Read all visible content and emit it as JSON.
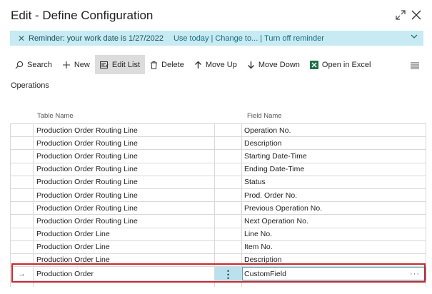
{
  "window": {
    "title": "Edit - Define Configuration"
  },
  "banner": {
    "message": "Reminder: your work date is 1/27/2022",
    "links": [
      "Use today",
      "Change to...",
      "Turn off reminder"
    ]
  },
  "toolbar": {
    "search": "Search",
    "new": "New",
    "edit_list": "Edit List",
    "delete": "Delete",
    "move_up": "Move Up",
    "move_down": "Move Down",
    "open_in_excel": "Open in Excel"
  },
  "section_title": "Operations",
  "columns": {
    "table_name": "Table Name",
    "field_name": "Field Name"
  },
  "rows": [
    {
      "table": "Production Order Routing Line",
      "field": "Operation No."
    },
    {
      "table": "Production Order Routing Line",
      "field": "Description"
    },
    {
      "table": "Production Order Routing Line",
      "field": "Starting Date-Time"
    },
    {
      "table": "Production Order Routing Line",
      "field": "Ending Date-Time"
    },
    {
      "table": "Production Order Routing Line",
      "field": "Status"
    },
    {
      "table": "Production Order Routing Line",
      "field": "Prod. Order No."
    },
    {
      "table": "Production Order Routing Line",
      "field": "Previous Operation No."
    },
    {
      "table": "Production Order Routing Line",
      "field": "Next Operation No."
    },
    {
      "table": "Production Order Line",
      "field": "Line No."
    },
    {
      "table": "Production Order Line",
      "field": "Item No."
    },
    {
      "table": "Production Order Line",
      "field": "Description"
    }
  ],
  "selected_row": {
    "indicator": "→",
    "table": "Production Order",
    "field": "CustomField",
    "more": "···",
    "menu": "⋮"
  },
  "colors": {
    "banner_bg": "#c7eaf3",
    "selected_cell": "#b9e2ee",
    "highlight": "#c8282e"
  }
}
